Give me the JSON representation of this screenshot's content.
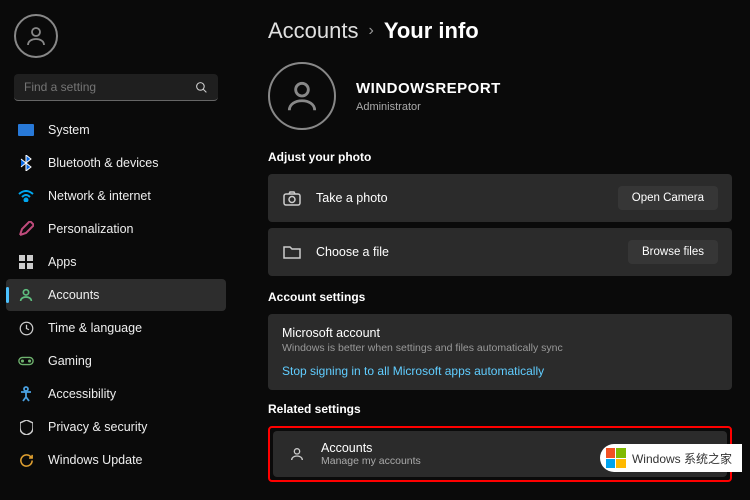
{
  "search": {
    "placeholder": "Find a setting"
  },
  "sidebar": {
    "items": [
      {
        "label": "System",
        "icon": "system-icon",
        "color": "#2879d8"
      },
      {
        "label": "Bluetooth & devices",
        "icon": "bluetooth-icon",
        "color": "#0a6ae6"
      },
      {
        "label": "Network & internet",
        "icon": "network-icon",
        "color": "#00a8f0"
      },
      {
        "label": "Personalization",
        "icon": "personalization-icon",
        "color": "#c04b7c"
      },
      {
        "label": "Apps",
        "icon": "apps-icon",
        "color": "#cccccc"
      },
      {
        "label": "Accounts",
        "icon": "accounts-icon",
        "color": "#5fbf7f",
        "active": true
      },
      {
        "label": "Time & language",
        "icon": "time-icon",
        "color": "#cccccc"
      },
      {
        "label": "Gaming",
        "icon": "gaming-icon",
        "color": "#6fb36f"
      },
      {
        "label": "Accessibility",
        "icon": "accessibility-icon",
        "color": "#4aa0e0"
      },
      {
        "label": "Privacy & security",
        "icon": "privacy-icon",
        "color": "#cccccc"
      },
      {
        "label": "Windows Update",
        "icon": "update-icon",
        "color": "#e0a030"
      }
    ]
  },
  "breadcrumb": {
    "parent": "Accounts",
    "current": "Your info"
  },
  "user": {
    "name": "WINDOWSREPORT",
    "role": "Administrator"
  },
  "sections": {
    "photo": {
      "title": "Adjust your photo",
      "takePhoto": {
        "label": "Take a photo",
        "button": "Open Camera"
      },
      "chooseFile": {
        "label": "Choose a file",
        "button": "Browse files"
      }
    },
    "account": {
      "title": "Account settings",
      "msAccount": {
        "title": "Microsoft account",
        "sub": "Windows is better when settings and files automatically sync"
      },
      "link": "Stop signing in to all Microsoft apps automatically"
    },
    "related": {
      "title": "Related settings",
      "accounts": {
        "title": "Accounts",
        "sub": "Manage my accounts"
      }
    }
  },
  "watermark": "Windows 系统之家"
}
